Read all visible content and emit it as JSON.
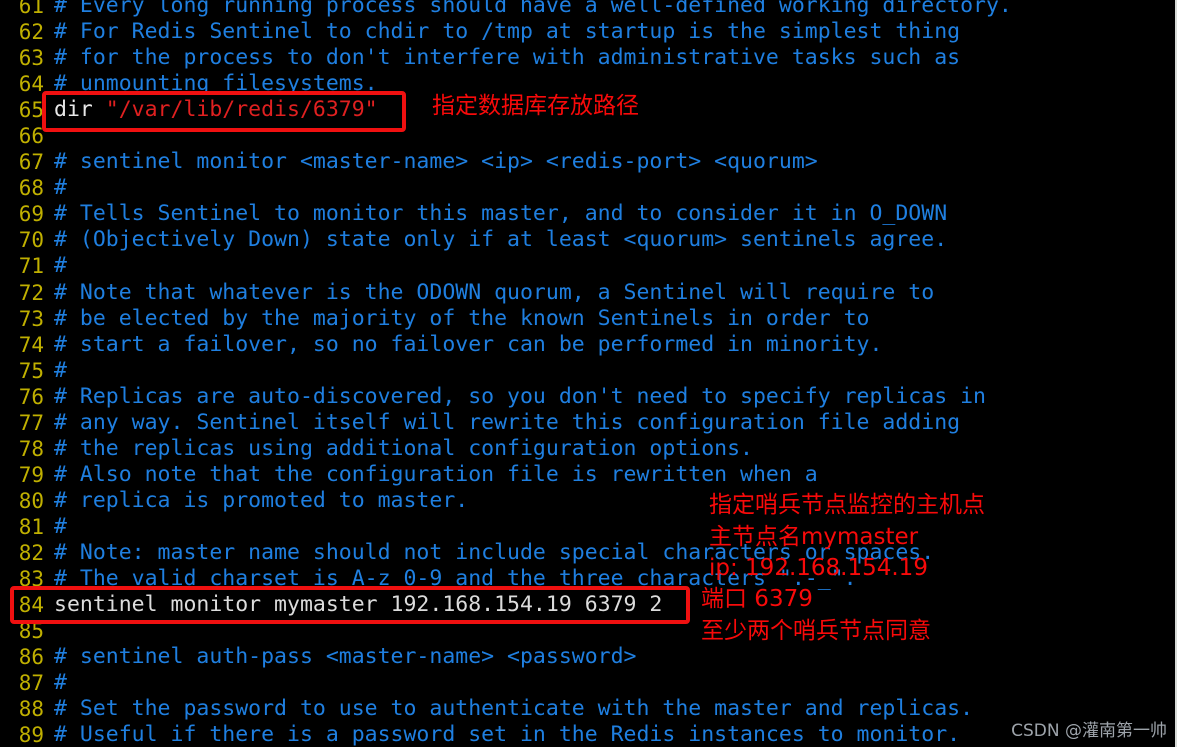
{
  "editor": {
    "background_color": "#000000",
    "line_number_color": "#c0b000",
    "comment_color": "#1f7fe0",
    "string_color": "#e02020",
    "keyword_color": "#e8e8e8",
    "first_visible_line": 61,
    "last_visible_line": 89,
    "lines": [
      {
        "num": "61",
        "segments": [
          {
            "cls": "cmt",
            "text": "# Every long running process should have a well-defined working directory."
          }
        ]
      },
      {
        "num": "62",
        "segments": [
          {
            "cls": "cmt",
            "text": "# For Redis Sentinel to chdir to /tmp at startup is the simplest thing"
          }
        ]
      },
      {
        "num": "63",
        "segments": [
          {
            "cls": "cmt",
            "text": "# for the process to don't interfere with administrative tasks such as"
          }
        ]
      },
      {
        "num": "64",
        "segments": [
          {
            "cls": "cmt",
            "text": "# unmounting filesystems."
          }
        ]
      },
      {
        "num": "65",
        "segments": [
          {
            "cls": "kw",
            "text": "dir "
          },
          {
            "cls": "str",
            "text": "\"/var/lib/redis/6379\""
          }
        ]
      },
      {
        "num": "66",
        "segments": [
          {
            "cls": "plain",
            "text": ""
          }
        ]
      },
      {
        "num": "67",
        "segments": [
          {
            "cls": "cmt",
            "text": "# sentinel monitor <master-name> <ip> <redis-port> <quorum>"
          }
        ]
      },
      {
        "num": "68",
        "segments": [
          {
            "cls": "cmt",
            "text": "#"
          }
        ]
      },
      {
        "num": "69",
        "segments": [
          {
            "cls": "cmt",
            "text": "# Tells Sentinel to monitor this master, and to consider it in O_DOWN"
          }
        ]
      },
      {
        "num": "70",
        "segments": [
          {
            "cls": "cmt",
            "text": "# (Objectively Down) state only if at least <quorum> sentinels agree."
          }
        ]
      },
      {
        "num": "71",
        "segments": [
          {
            "cls": "cmt",
            "text": "#"
          }
        ]
      },
      {
        "num": "72",
        "segments": [
          {
            "cls": "cmt",
            "text": "# Note that whatever is the ODOWN quorum, a Sentinel will require to"
          }
        ]
      },
      {
        "num": "73",
        "segments": [
          {
            "cls": "cmt",
            "text": "# be elected by the majority of the known Sentinels in order to"
          }
        ]
      },
      {
        "num": "74",
        "segments": [
          {
            "cls": "cmt",
            "text": "# start a failover, so no failover can be performed in minority."
          }
        ]
      },
      {
        "num": "75",
        "segments": [
          {
            "cls": "cmt",
            "text": "#"
          }
        ]
      },
      {
        "num": "76",
        "segments": [
          {
            "cls": "cmt",
            "text": "# Replicas are auto-discovered, so you don't need to specify replicas in"
          }
        ]
      },
      {
        "num": "77",
        "segments": [
          {
            "cls": "cmt",
            "text": "# any way. Sentinel itself will rewrite this configuration file adding"
          }
        ]
      },
      {
        "num": "78",
        "segments": [
          {
            "cls": "cmt",
            "text": "# the replicas using additional configuration options."
          }
        ]
      },
      {
        "num": "79",
        "segments": [
          {
            "cls": "cmt",
            "text": "# Also note that the configuration file is rewritten when a"
          }
        ]
      },
      {
        "num": "80",
        "segments": [
          {
            "cls": "cmt",
            "text": "# replica is promoted to master."
          }
        ]
      },
      {
        "num": "81",
        "segments": [
          {
            "cls": "cmt",
            "text": "#"
          }
        ]
      },
      {
        "num": "82",
        "segments": [
          {
            "cls": "cmt",
            "text": "# Note: master name should not include special characters or spaces."
          }
        ]
      },
      {
        "num": "83",
        "segments": [
          {
            "cls": "cmt",
            "text": "# The valid charset is A-z 0-9 and the three characters \".-_\"."
          }
        ]
      },
      {
        "num": "84",
        "segments": [
          {
            "cls": "plain",
            "text": "sentinel monitor mymaster 192.168.154.19 6379 2"
          }
        ]
      },
      {
        "num": "85",
        "segments": [
          {
            "cls": "plain",
            "text": ""
          }
        ]
      },
      {
        "num": "86",
        "segments": [
          {
            "cls": "cmt",
            "text": "# sentinel auth-pass <master-name> <password>"
          }
        ]
      },
      {
        "num": "87",
        "segments": [
          {
            "cls": "cmt",
            "text": "#"
          }
        ]
      },
      {
        "num": "88",
        "segments": [
          {
            "cls": "cmt",
            "text": "# Set the password to use to authenticate with the master and replicas."
          }
        ]
      },
      {
        "num": "89",
        "segments": [
          {
            "cls": "cmt",
            "text": "# Useful if there is a password set in the Redis instances to monitor."
          }
        ]
      }
    ]
  },
  "annotations": {
    "color": "#f80a0a",
    "dir_note": "指定数据库存放路径",
    "monitor_note_1": "指定哨兵节点监控的主机点",
    "monitor_note_2": "主节点名mymaster",
    "monitor_note_3": "ip: 192.168.154.19",
    "monitor_note_4": "端口 6379",
    "monitor_note_5": "至少两个哨兵节点同意"
  },
  "watermark": {
    "text": "CSDN @灌南第一帅"
  }
}
